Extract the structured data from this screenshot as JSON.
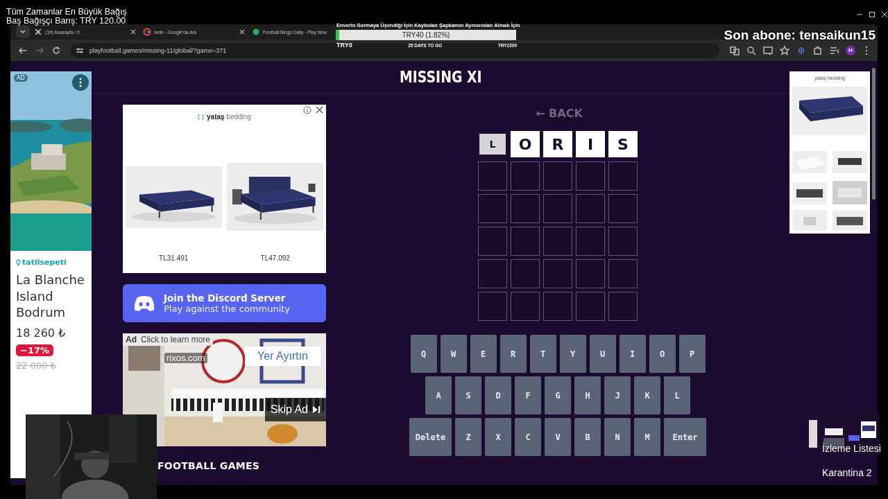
{
  "stream_overlay": {
    "donation_lines": [
      "Tüm Zamanlar En Büyük Bağış",
      "Baş Bağışçı Barış: TRY 120.00"
    ],
    "latest_subscriber": "Son abone: tensaikun15",
    "watchlist_label": "İzleme Listesi",
    "scene_label": "Karantina 2"
  },
  "goal": {
    "title": "Enverin Sormaya Üşendiği İçin Kaybolan Şapkamın Aynısından Almak İçin",
    "level": 0.0182,
    "reading": "TRY40 (1.82%)",
    "start": "TRY0",
    "time_left": "25 DAYS TO GO",
    "target": "TRY2200"
  },
  "browser": {
    "tabs": [
      {
        "label": "(19) Anasayfa / X",
        "kind": "x",
        "close_button": true
      },
      {
        "label": "lunin - Google'da Ara",
        "kind": "google",
        "close_button": true
      },
      {
        "label": "Football Bingo Daily - Play Now",
        "kind": "site",
        "close_button": false
      }
    ],
    "url": "playfootball.games/missing-11/global/?game=371",
    "profile": "H"
  },
  "left_ad": {
    "badge": "AD",
    "brand": "tatilsepeti",
    "title": "La Blanche Island Bodrum",
    "price": "18 260 ₺",
    "discount": "−17%",
    "old_price": "22 000 ₺"
  },
  "bed_ad": {
    "brand": "**yataş** bedding",
    "prices": [
      "TL31.491",
      "TL47.092"
    ]
  },
  "right_ad": {
    "brand": "yataş bedding"
  },
  "discord": {
    "title": "Join the Discord Server",
    "subtitle": "Play against the community"
  },
  "video_ad": {
    "badge": "Ad",
    "hint": "Click to learn more",
    "domain": "rixos.com",
    "cta": "Yer Ayırtın",
    "skip": "Skip Ad"
  },
  "section_heading": "FOOTBALL GAMES",
  "game": {
    "title": "MISSING XI",
    "back": "← BACK",
    "guess": [
      {
        "letter": "L",
        "selected": true
      },
      {
        "letter": "O",
        "selected": false
      },
      {
        "letter": "R",
        "selected": false
      },
      {
        "letter": "I",
        "selected": false
      },
      {
        "letter": "S",
        "selected": false
      }
    ],
    "keyboard": {
      "rows": [
        [
          "Q",
          "W",
          "E",
          "R",
          "T",
          "Y",
          "U",
          "I",
          "O",
          "P"
        ],
        [
          "A",
          "S",
          "D",
          "F",
          "G",
          "H",
          "J",
          "K",
          "L"
        ],
        [
          "Z",
          "X",
          "C",
          "V",
          "B",
          "N",
          "M"
        ]
      ],
      "delete": "Delete",
      "enter": "Enter"
    }
  }
}
